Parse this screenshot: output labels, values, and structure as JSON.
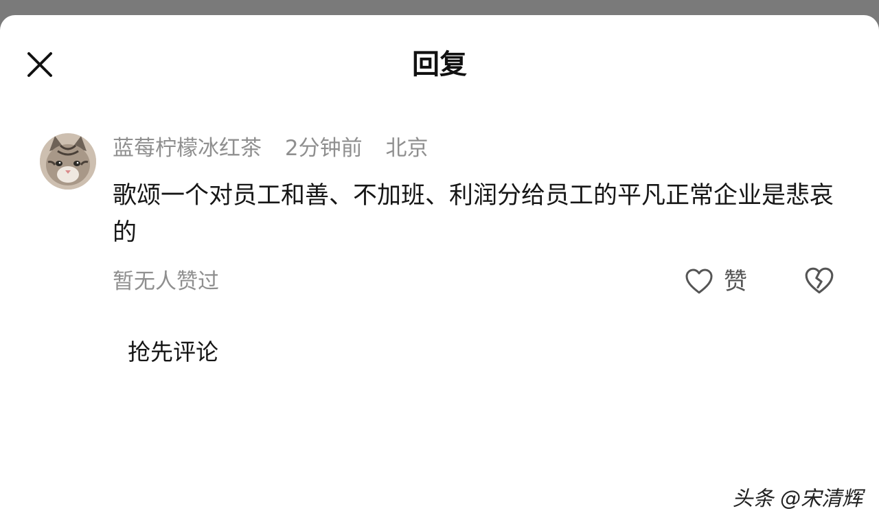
{
  "header": {
    "title": "回复",
    "close_icon": "close-icon"
  },
  "comment": {
    "avatar_icon": "cat-avatar",
    "username": "蓝莓柠檬冰红茶",
    "time": "2分钟前",
    "location": "北京",
    "text": "歌颂一个对员工和善、不加班、利润分给员工的平凡正常企业是悲哀的",
    "likes_status": "暂无人赞过",
    "like_label": "赞",
    "like_icon": "heart-outline-icon",
    "dislike_icon": "broken-heart-icon"
  },
  "reply": {
    "prompt": "抢先评论"
  },
  "watermark": {
    "text": "头条 @宋清辉"
  },
  "colors": {
    "backdrop": "#7a7a7a",
    "sheet": "#ffffff",
    "primary_text": "#161616",
    "secondary_text": "#8f8f8f"
  }
}
